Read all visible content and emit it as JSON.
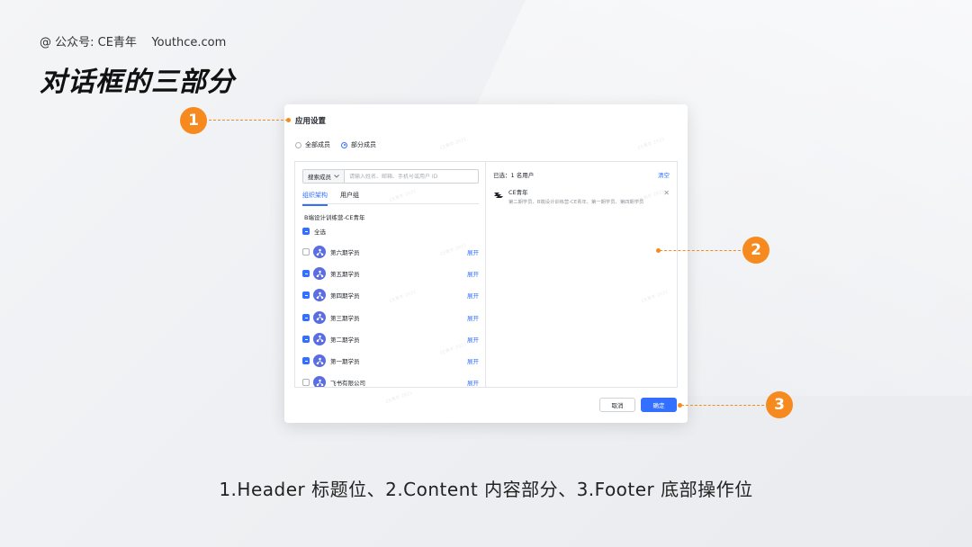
{
  "credit": "@ 公众号: CE青年    Youthce.com",
  "main_title": "对话框的三部分",
  "dialog": {
    "title": "应用设置",
    "radio_options": [
      "全部成员",
      "部分成员"
    ],
    "selected_radio": "部分成员",
    "search": {
      "select_label": "搜索成员",
      "placeholder": "请输入姓名、邮箱、手机号或用户 ID"
    },
    "tabs": [
      "组织架构",
      "用户组"
    ],
    "active_tab": "组织架构",
    "org_name": "B端设计训练营-CE青年",
    "select_all_label": "全选",
    "groups": [
      {
        "name": "第六期学员",
        "checked": "unchecked",
        "action": "展开"
      },
      {
        "name": "第五期学员",
        "checked": "indeterminate",
        "action": "展开"
      },
      {
        "name": "第四期学员",
        "checked": "indeterminate",
        "action": "展开"
      },
      {
        "name": "第三期学员",
        "checked": "indeterminate",
        "action": "展开"
      },
      {
        "name": "第二期学员",
        "checked": "indeterminate",
        "action": "展开"
      },
      {
        "name": "第一期学员",
        "checked": "indeterminate",
        "action": "展开"
      },
      {
        "name": "飞书有限公司",
        "checked": "unchecked",
        "action": "展开"
      }
    ],
    "selected_summary": "已选：1 名用户",
    "clear_label": "清空",
    "selected_user": {
      "name": "CE青年",
      "description": "第二期学员、B端设计训练营-CE青年、第一期学员、第四期学员"
    },
    "cancel_label": "取消",
    "ok_label": "确定",
    "watermark_text": "CE青年 2021"
  },
  "markers": [
    "1",
    "2",
    "3"
  ],
  "caption": "1.Header 标题位、2.Content 内容部分、3.Footer 底部操作位",
  "colors": {
    "accent": "#f68a1e",
    "primary": "#3370ff",
    "avatar": "#5b6ee1"
  }
}
